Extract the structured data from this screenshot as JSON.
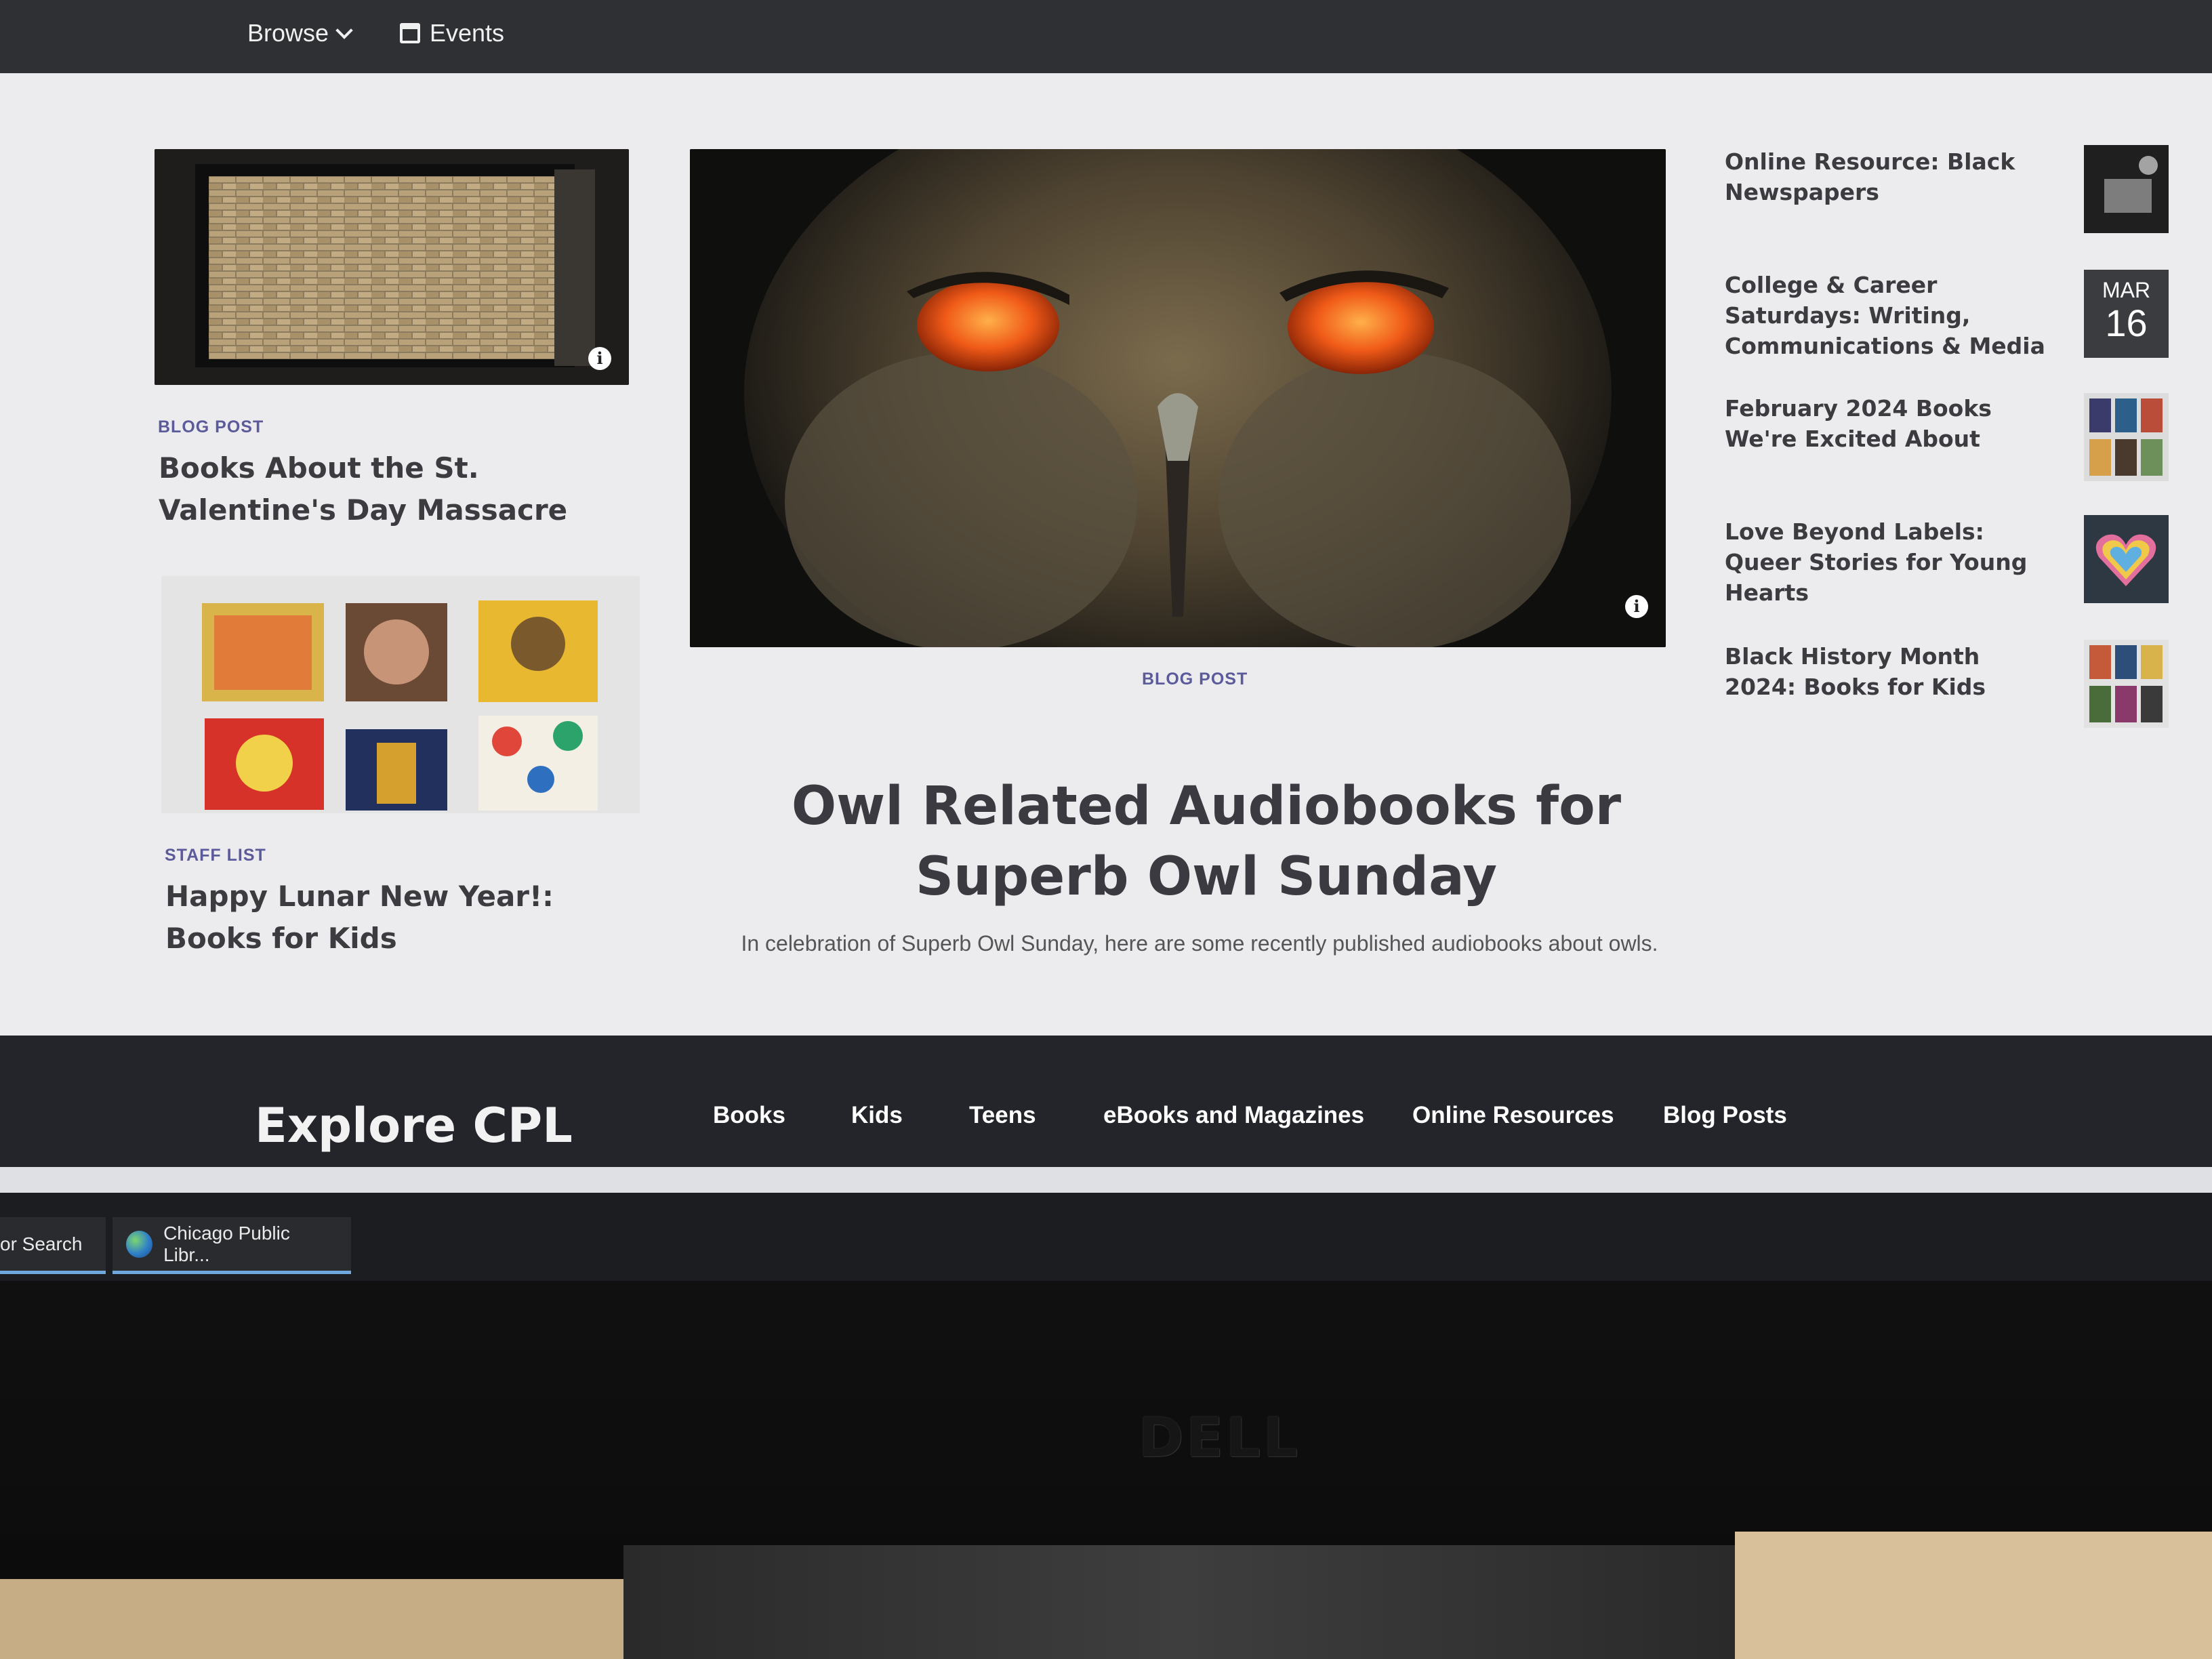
{
  "topnav": {
    "browse_label": "Browse",
    "events_label": "Events"
  },
  "cards": {
    "valentine": {
      "tag": "BLOG POST",
      "title": "Books About the St. Valentine's Day Massacre"
    },
    "lunar": {
      "tag": "STAFF LIST",
      "title": "Happy Lunar New Year!: Books for Kids"
    }
  },
  "hero": {
    "tag": "BLOG POST",
    "title": "Owl Related Audiobooks for Superb Owl Sunday",
    "summary": "In celebration of Superb Owl Sunday, here are some recently published audiobooks about owls."
  },
  "sidebar": {
    "items": [
      {
        "title": "Online Resource: Black Newspapers"
      },
      {
        "title": "College & Career Saturdays: Writing, Communications & Media",
        "date_month": "MAR",
        "date_day": "16"
      },
      {
        "title": "February 2024 Books We're Excited About"
      },
      {
        "title": "Love Beyond Labels: Queer Stories for Young Hearts"
      },
      {
        "title": "Black History Month 2024: Books for Kids"
      }
    ]
  },
  "footer": {
    "title": "Explore CPL",
    "links": [
      "Books",
      "Kids",
      "Teens",
      "eBooks and Magazines",
      "Online Resources",
      "Blog Posts"
    ]
  },
  "taskbar": {
    "search_label": "or Search",
    "window_label": "Chicago Public Libr..."
  },
  "monitor": {
    "brand": "DELL"
  },
  "colors": {
    "accent_tag": "#5b5a9a",
    "footer_bg": "#23252a",
    "nav_bg": "#2e3033"
  }
}
